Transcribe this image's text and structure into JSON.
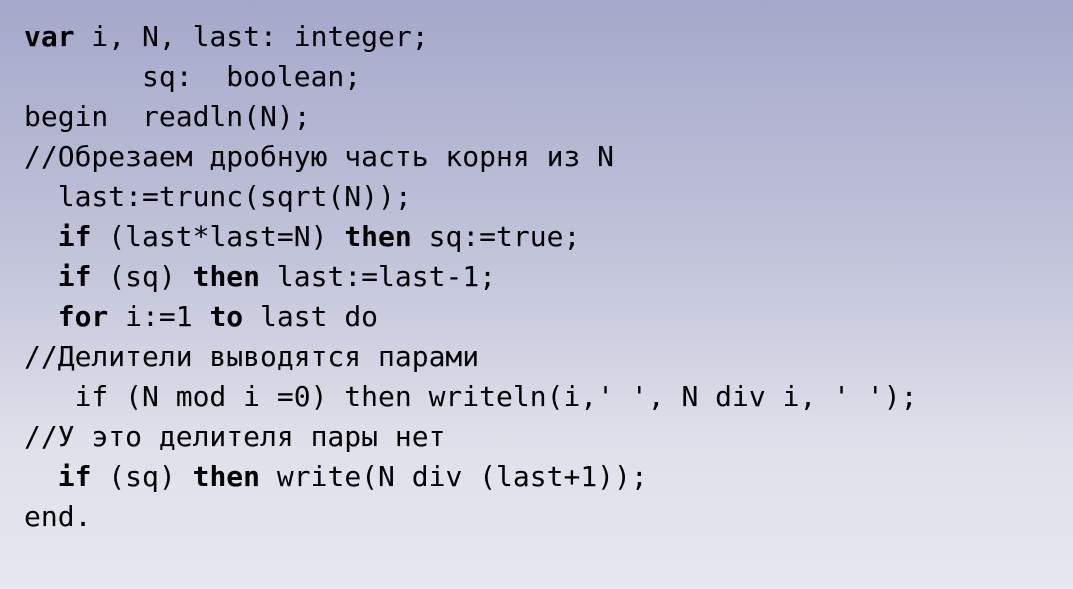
{
  "code": {
    "lines": [
      [
        {
          "t": "var",
          "b": true
        },
        {
          "t": " i, N, last: integer;"
        }
      ],
      [
        {
          "t": "       sq:  boolean;"
        }
      ],
      [
        {
          "t": "begin  readln(N);"
        }
      ],
      [
        {
          "t": "//Обрезаем дробную часть корня из N"
        }
      ],
      [
        {
          "t": "  last:=trunc(sqrt(N));"
        }
      ],
      [
        {
          "t": "  "
        },
        {
          "t": "if",
          "b": true
        },
        {
          "t": " (last*last=N) "
        },
        {
          "t": "then",
          "b": true
        },
        {
          "t": " sq:=true;"
        }
      ],
      [
        {
          "t": "  "
        },
        {
          "t": "if",
          "b": true
        },
        {
          "t": " (sq) "
        },
        {
          "t": "then",
          "b": true
        },
        {
          "t": " last:=last-1;"
        }
      ],
      [
        {
          "t": "  "
        },
        {
          "t": "for",
          "b": true
        },
        {
          "t": " i:=1 "
        },
        {
          "t": "to",
          "b": true
        },
        {
          "t": " last do"
        }
      ],
      [
        {
          "t": "//Делители выводятся парами"
        }
      ],
      [
        {
          "t": "   if (N mod i =0) then writeln(i,' ', N div i, ' ');"
        }
      ],
      [
        {
          "t": "//У это делителя пары нет"
        }
      ],
      [
        {
          "t": "  "
        },
        {
          "t": "if",
          "b": true
        },
        {
          "t": " (sq) "
        },
        {
          "t": "then",
          "b": true
        },
        {
          "t": " write(N div (last+1));"
        }
      ],
      [
        {
          "t": "end."
        }
      ]
    ]
  },
  "colors": {
    "text": "#000000",
    "background_top": "#a5a8ca",
    "background_bottom": "#e6e7ef"
  }
}
